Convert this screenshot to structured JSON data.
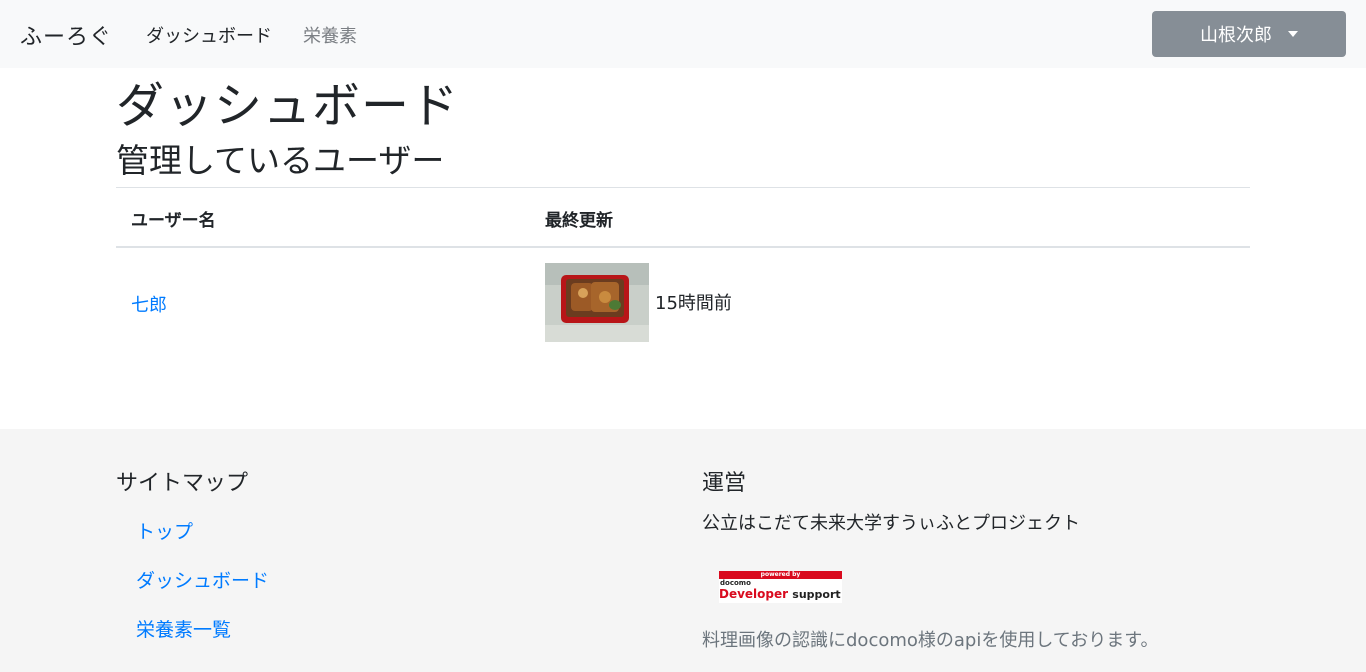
{
  "navbar": {
    "brand": "ふーろぐ",
    "links": [
      {
        "label": "ダッシュボード",
        "active": true
      },
      {
        "label": "栄養素",
        "active": false
      }
    ],
    "user_button": "山根次郎"
  },
  "main": {
    "title": "ダッシュボード",
    "subtitle": "管理しているユーザー",
    "table": {
      "headers": [
        "ユーザー名",
        "最終更新"
      ],
      "rows": [
        {
          "user": "七郎",
          "last_update": "15時間前"
        }
      ]
    }
  },
  "footer": {
    "sitemap": {
      "heading": "サイトマップ",
      "links": [
        "トップ",
        "ダッシュボード",
        "栄養素一覧"
      ]
    },
    "operator": {
      "heading": "運営",
      "text": "公立はこだて未来大学すうぃふとプロジェクト",
      "badge": {
        "top": "powered by",
        "small": "docomo",
        "main": "Developer",
        "sub": "support"
      },
      "note": "料理画像の認識にdocomo様のapiを使用しております。"
    }
  },
  "colors": {
    "link": "#007bff",
    "navbar_bg": "#f8f9fa",
    "user_button_bg": "#868e96",
    "footer_bg": "#f5f5f5",
    "docomo_red": "#d90a1e"
  }
}
